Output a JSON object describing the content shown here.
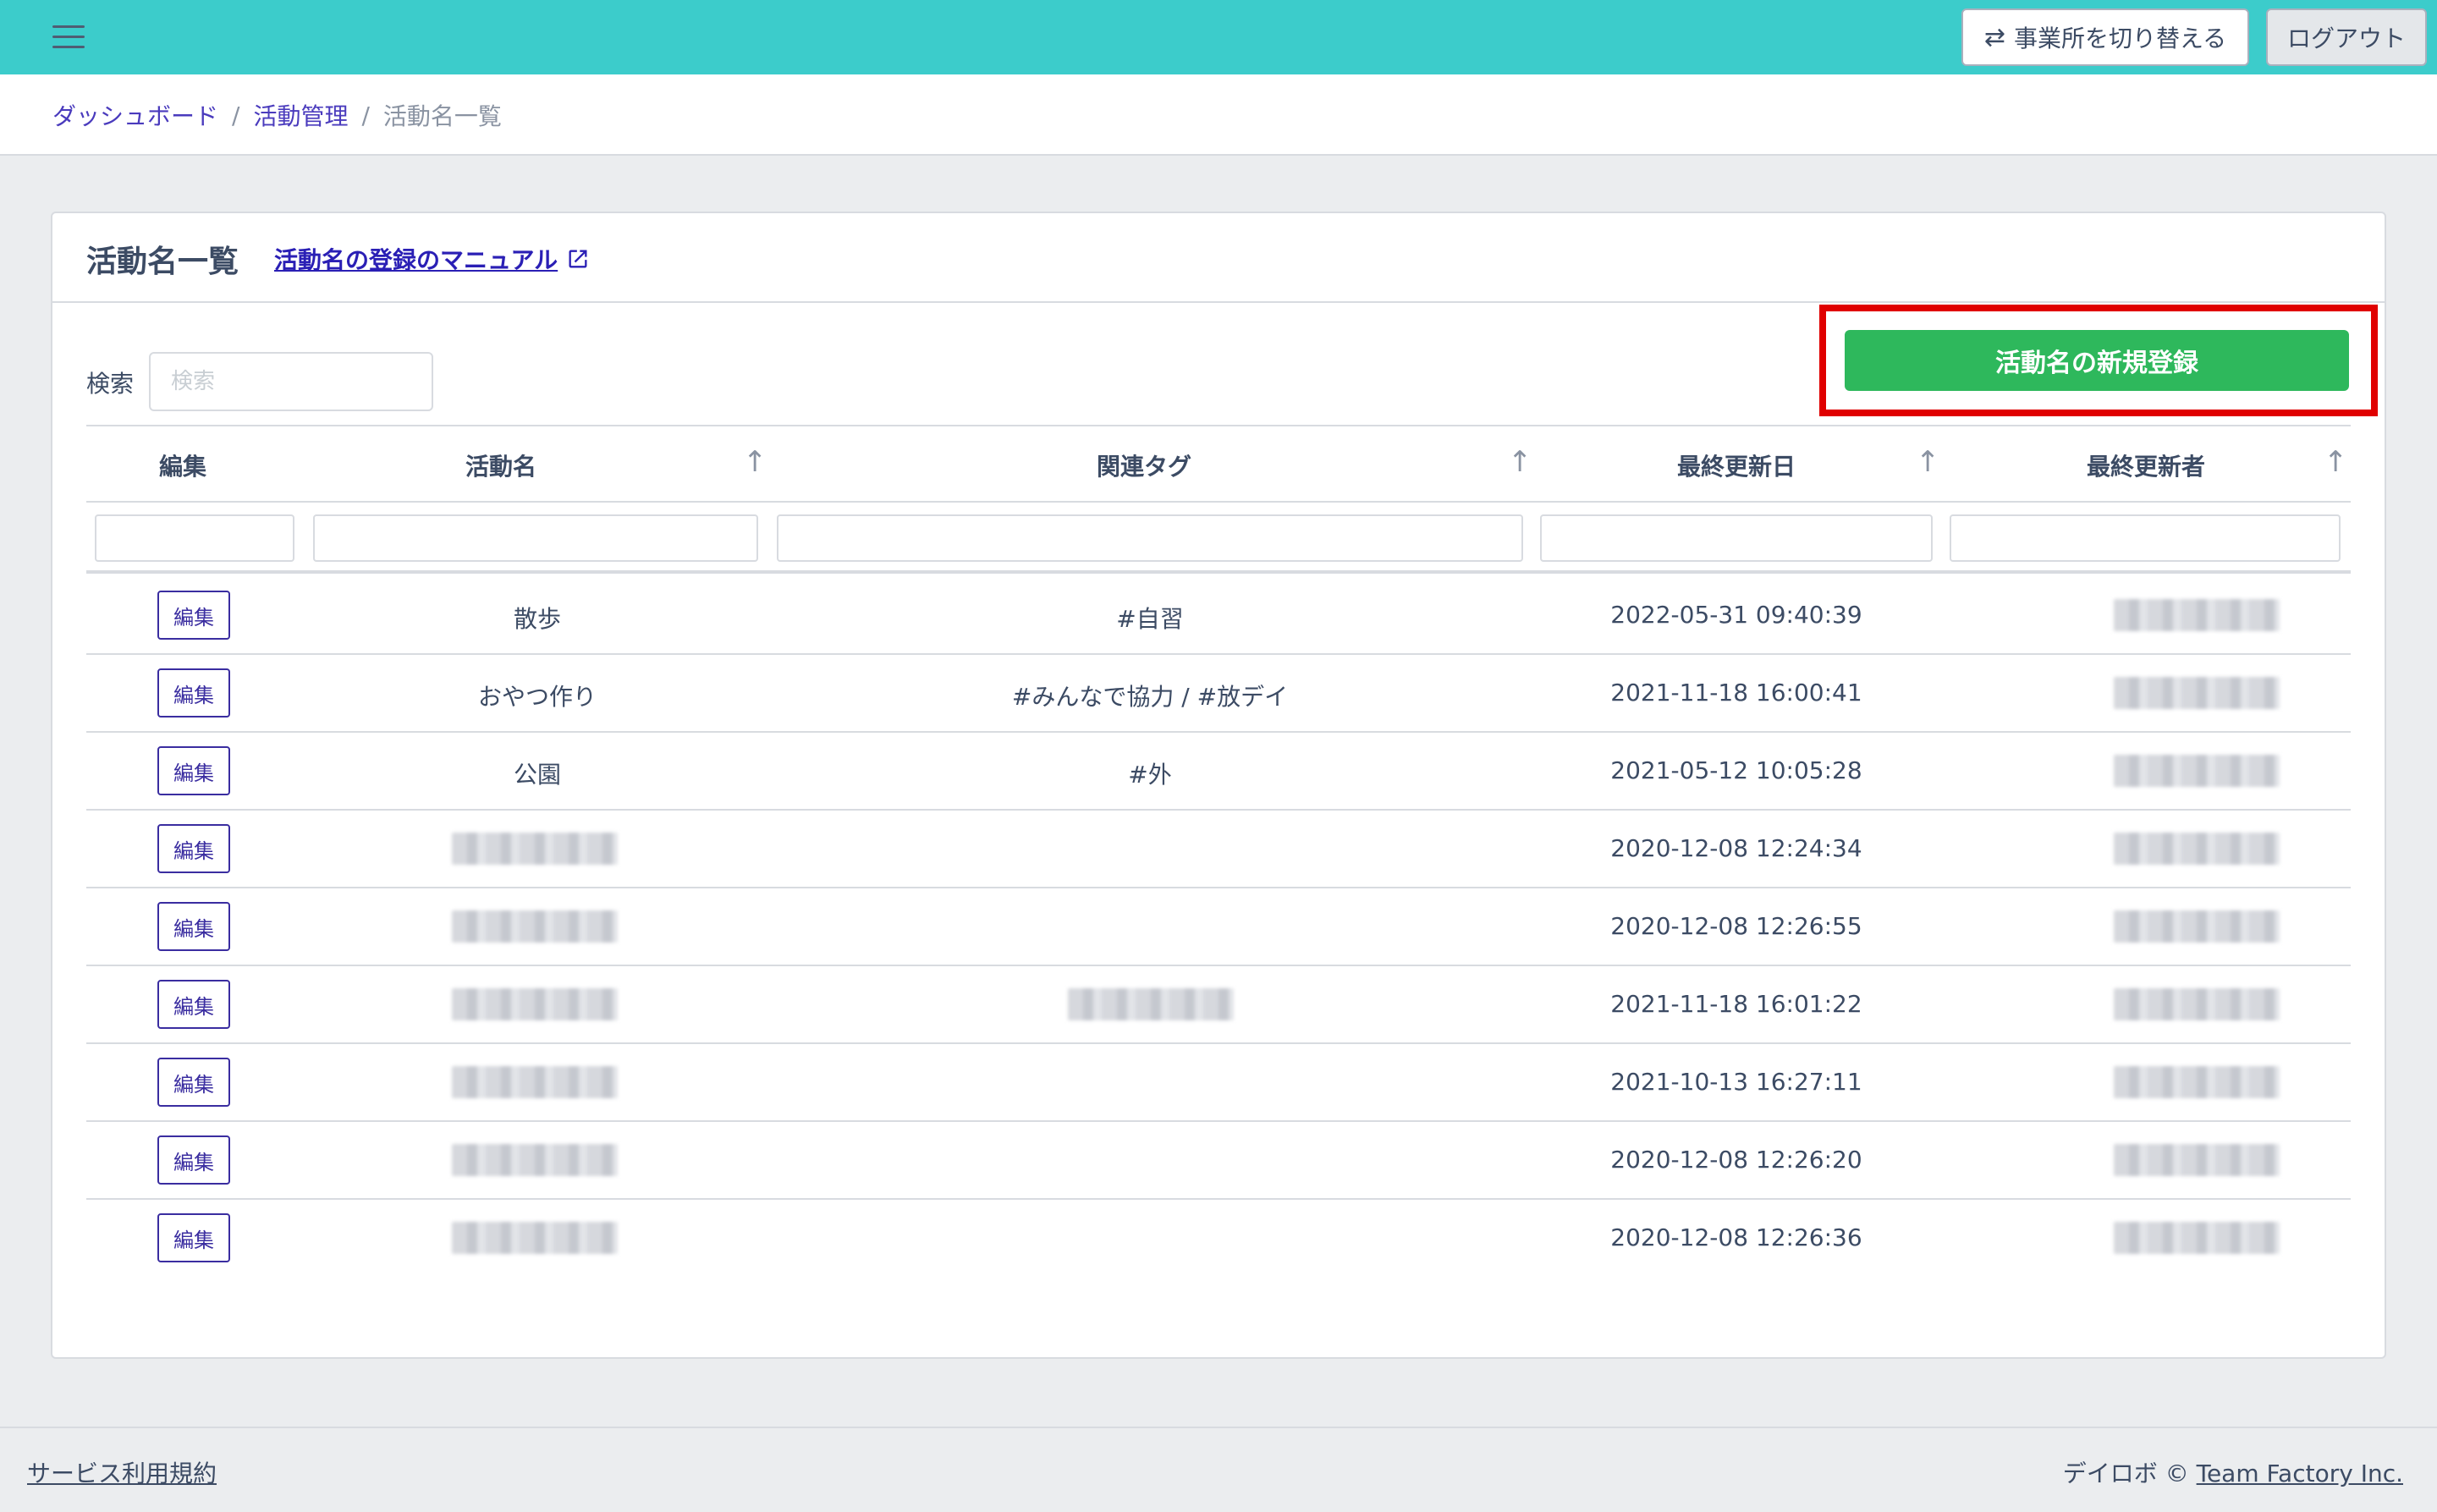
{
  "header": {
    "switch_office_label": "事業所を切り替える",
    "switch_icon": "⇄",
    "logout_label": "ログアウト"
  },
  "breadcrumb": {
    "items": [
      "ダッシュボード",
      "活動管理",
      "活動名一覧"
    ],
    "separator": "/"
  },
  "card": {
    "title": "活動名一覧",
    "manual_link": "活動名の登録のマニュアル",
    "external_icon": "⧉",
    "search_label": "検索",
    "search_placeholder": "検索",
    "new_button": "活動名の新規登録"
  },
  "table": {
    "columns": [
      "編集",
      "活動名",
      "関連タグ",
      "最終更新日",
      "最終更新者"
    ],
    "sort_icon": "↑",
    "edit_label": "編集",
    "rows": [
      {
        "name": "散歩",
        "tag": "#自習",
        "updated": "2022-05-31 09:40:39",
        "name_blurred": false,
        "tag_blurred": false
      },
      {
        "name": "おやつ作り",
        "tag": "#みんなで協力 / #放デイ",
        "updated": "2021-11-18 16:00:41",
        "name_blurred": false,
        "tag_blurred": false
      },
      {
        "name": "公園",
        "tag": "#外",
        "updated": "2021-05-12 10:05:28",
        "name_blurred": false,
        "tag_blurred": false
      },
      {
        "name": "",
        "tag": "",
        "updated": "2020-12-08 12:24:34",
        "name_blurred": true,
        "tag_blurred": false
      },
      {
        "name": "",
        "tag": "",
        "updated": "2020-12-08 12:26:55",
        "name_blurred": true,
        "tag_blurred": false
      },
      {
        "name": "",
        "tag": "",
        "updated": "2021-11-18 16:01:22",
        "name_blurred": true,
        "tag_blurred": true
      },
      {
        "name": "",
        "tag": "",
        "updated": "2021-10-13 16:27:11",
        "name_blurred": true,
        "tag_blurred": false
      },
      {
        "name": "",
        "tag": "",
        "updated": "2020-12-08 12:26:20",
        "name_blurred": true,
        "tag_blurred": false
      },
      {
        "name": "",
        "tag": "",
        "updated": "2020-12-08 12:26:36",
        "name_blurred": true,
        "tag_blurred": false
      }
    ]
  },
  "footer": {
    "terms": "サービス利用規約",
    "copyright_prefix": "デイロボ ©",
    "company": "Team Factory Inc."
  },
  "colors": {
    "topbar": "#3ccccb",
    "primary_button": "#2eb85c",
    "highlight": "#e00000",
    "link": "#2a1fb5"
  }
}
